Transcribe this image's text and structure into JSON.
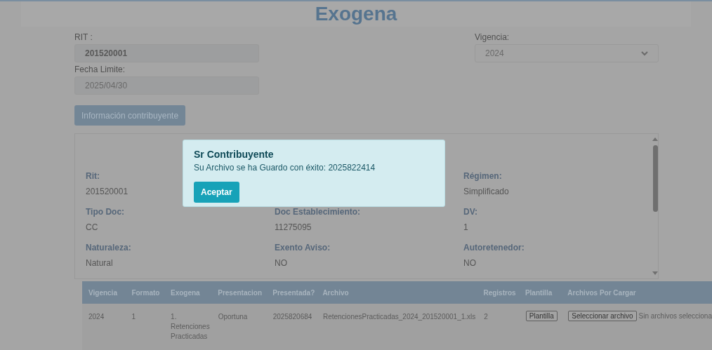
{
  "title": "Exogena",
  "form": {
    "rit_label": "RIT :",
    "rit_value": "201520001",
    "fecha_label": "Fecha Limite:",
    "fecha_value": "2025/04/30",
    "vigencia_label": "Vigencia:",
    "vigencia_value": "2024",
    "info_button": "Información contribuyente"
  },
  "info_columns": [
    {
      "fields": [
        {
          "label": "Rit:",
          "value": "201520001"
        },
        {
          "label": "Tipo Doc:",
          "value": "CC"
        },
        {
          "label": "Naturaleza:",
          "value": "Natural"
        }
      ]
    },
    {
      "fields": [
        {
          "label": "Doc Establecimiento:",
          "value": "11275095"
        },
        {
          "label": "Exento Aviso:",
          "value": "NO"
        }
      ]
    },
    {
      "fields": [
        {
          "label": "Régimen:",
          "value": "Simplificado"
        },
        {
          "label": "DV:",
          "value": "1"
        },
        {
          "label": "Autoretenedor:",
          "value": "NO"
        }
      ]
    }
  ],
  "table": {
    "columns": [
      "Vigencia",
      "Formato",
      "Exogena",
      "Presentacion",
      "Presentada?",
      "Archivo",
      "Registros",
      "Plantilla",
      "Archivos Por Cargar"
    ],
    "rows": [
      {
        "vigencia": "2024",
        "formato": "1",
        "exogena": "1. Retenciones Practicadas",
        "presentacion": "Oportuna",
        "presentada": "2025820684",
        "archivo": "RetencionesPracticadas_2024_201520001_1.xls",
        "registros": "2",
        "plantilla_button": "Plantilla",
        "file_button": "Seleccionar archivo",
        "file_status": "Sin archivos selecciona"
      }
    ]
  },
  "dialog": {
    "title": "Sr Contribuyente",
    "message": "Su Archivo se ha Guardo con éxito: 2025822414",
    "button": "Aceptar"
  }
}
